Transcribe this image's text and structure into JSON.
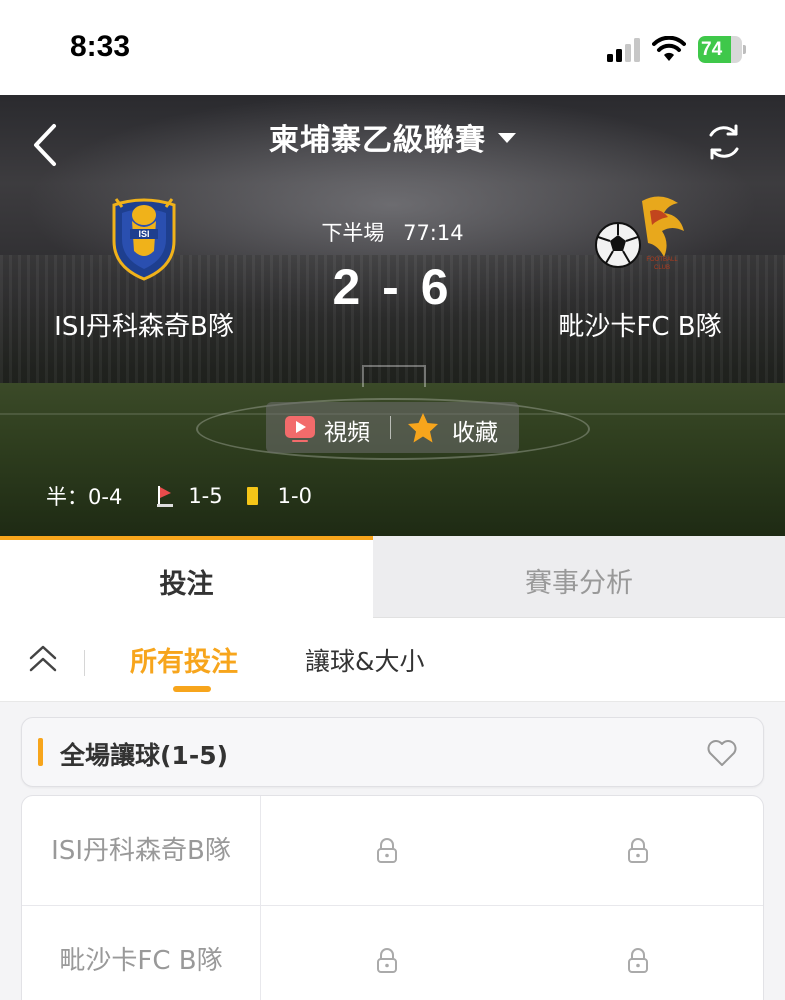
{
  "status_bar": {
    "time": "8:33",
    "battery_percent": "74",
    "battery_level": 0.74,
    "battery_color": "#3fc84a",
    "icons": [
      "signal-icon",
      "wifi-icon",
      "battery-charging-icon"
    ]
  },
  "header": {
    "league_title": "柬埔寨乙級聯賽",
    "icons": [
      "back-icon",
      "chevron-down-icon",
      "refresh-icon"
    ]
  },
  "match": {
    "period": "下半場",
    "clock": "77:14",
    "score": "2 - 6",
    "home_team": "ISI丹科森奇B隊",
    "away_team": "毗沙卡FC B隊",
    "home_logo": "ganesha-crest-logo",
    "away_logo": "soccer-ball-crest-logo",
    "video_label": "視頻",
    "favorite_label": "收藏",
    "half_time": "半：0-4",
    "corners": "1-5",
    "yellow_cards": "1-0"
  },
  "tabs": {
    "bet": "投注",
    "analysis": "賽事分析"
  },
  "sub_tabs": {
    "all_bets": "所有投注",
    "handicap_ou": "讓球&大小"
  },
  "market": {
    "title": "全場讓球(1-5)",
    "rows": [
      {
        "team": "ISI丹科森奇B隊",
        "cells": [
          "locked",
          "locked"
        ]
      },
      {
        "team": "毗沙卡FC B隊",
        "cells": [
          "locked",
          "locked"
        ]
      }
    ]
  },
  "colors": {
    "accent": "#f7a51c",
    "yellow_card": "#f5c518",
    "video_icon": "#f26b6b"
  }
}
